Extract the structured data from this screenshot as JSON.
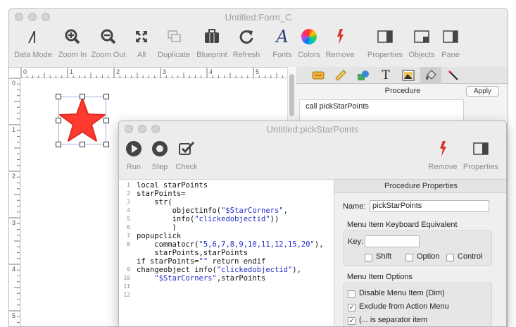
{
  "win1": {
    "title": "Untitled:Form_C",
    "toolbar": {
      "data_mode": "Data Mode",
      "zoom_in": "Zoom In",
      "zoom_out": "Zoom Out",
      "all": "All",
      "duplicate": "Duplicate",
      "blueprint": "Blueprint",
      "refresh": "Refresh",
      "fonts": "Fonts",
      "colors": "Colors",
      "remove": "Remove",
      "properties": "Properties",
      "objects": "Objects",
      "pane": "Pane"
    },
    "ruler_h": [
      "0",
      "1",
      "2",
      "3",
      "4",
      "5"
    ],
    "ruler_v": [
      "0",
      "1",
      "2",
      "3",
      "4",
      "5"
    ],
    "star_color": "#ff3b2f",
    "palette_tabs": [
      "text-box-icon",
      "ruler-icon",
      "shapes-icon",
      "text-icon",
      "picture-icon",
      "paint-icon",
      "line-icon"
    ],
    "procedure": {
      "title": "Procedure",
      "apply": "Apply",
      "text": "call pickStarPoints"
    }
  },
  "win2": {
    "title": "Untitled:pickStarPoints",
    "toolbar": {
      "run": "Run",
      "step": "Step",
      "check": "Check",
      "remove": "Remove",
      "properties": "Properties"
    },
    "line_numbers": [
      "1",
      "2",
      "3",
      "4",
      "5",
      "6",
      "7",
      "8",
      "",
      "9",
      "10",
      "11",
      "12"
    ],
    "code_lines": [
      "local starPoints",
      "starPoints=",
      "    str(",
      "        objectinfo(\"$StarCorners\",",
      "        info(\"clickedobjectid\"))",
      "        )",
      "popupclick",
      "    commatocr(\"5,6,7,8,9,10,11,12,15,20\"),",
      "    starPoints,starPoints",
      "if starPoints=\"\" return endif",
      "changeobject info(\"clickedobjectid\"),",
      "    \"$StarCorners\",starPoints",
      "",
      ""
    ],
    "props": {
      "header": "Procedure Properties",
      "name_label": "Name:",
      "name_value": "pickStarPoints",
      "kbd_group": "Menu Item Keyboard Equivalent",
      "key_label": "Key:",
      "key_value": "",
      "shift": "Shift",
      "option": "Option",
      "control": "Control",
      "options_group": "Menu Item Options",
      "disable": "Disable Menu Item (Dim)",
      "exclude": "Exclude from Action Menu",
      "separator": "(... is separator item"
    },
    "checked": {
      "shift": false,
      "option": false,
      "control": false,
      "disable": false,
      "exclude": true,
      "separator": true
    }
  }
}
